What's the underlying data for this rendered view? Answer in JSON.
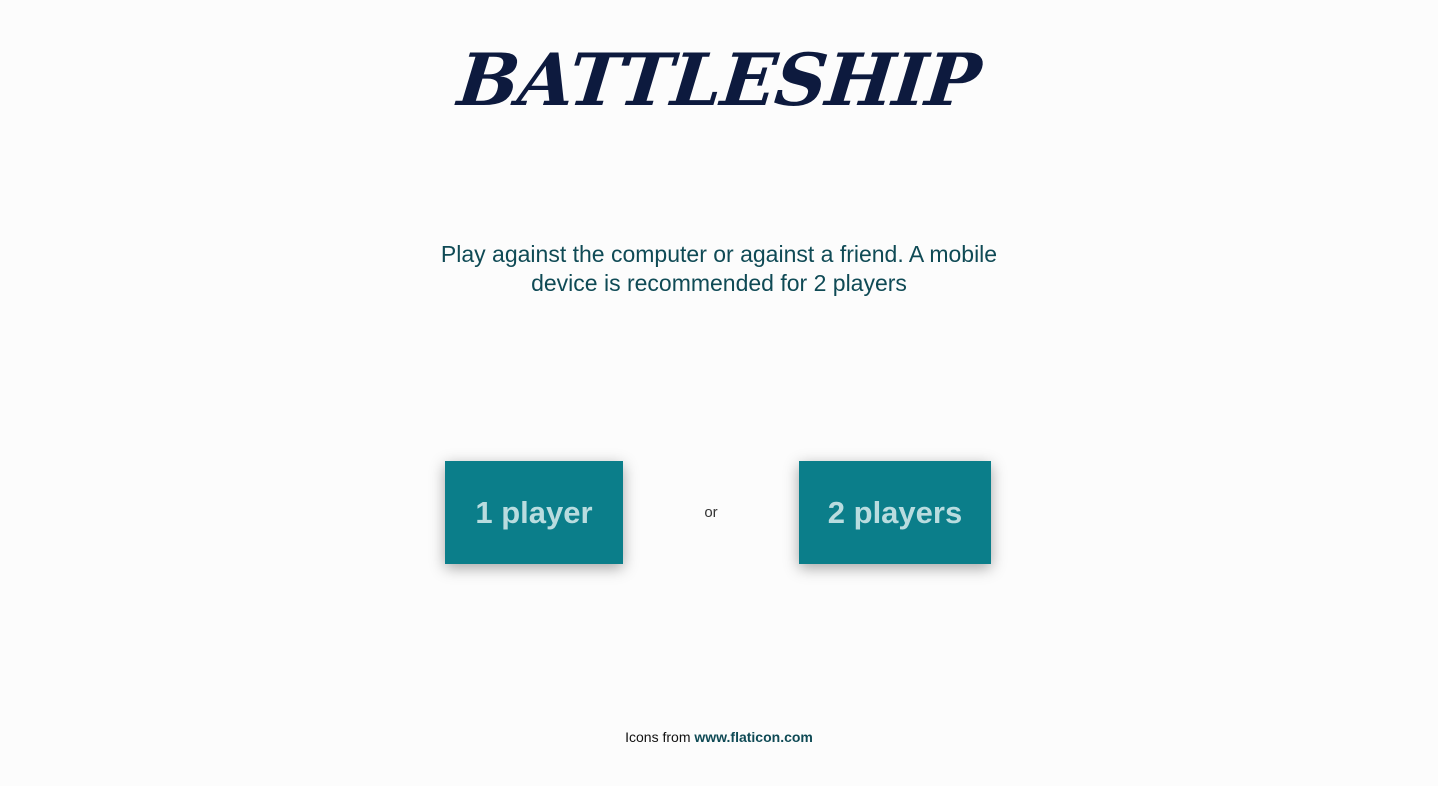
{
  "header": {
    "title": "BATTLESHIP"
  },
  "intro": {
    "text": "Play against the computer or against a friend. A mobile device is recommended for 2 players"
  },
  "modes": {
    "one_player_label": "1 player",
    "separator": "or",
    "two_players_label": "2 players"
  },
  "footer": {
    "prefix": "Icons from",
    "link_text": "www.flaticon.com"
  },
  "colors": {
    "background": "#fcfcfc",
    "title": "#0d1a3e",
    "subtitle": "#0f4a55",
    "button_bg": "#0b7e8a",
    "button_text": "#b9dcdf"
  }
}
